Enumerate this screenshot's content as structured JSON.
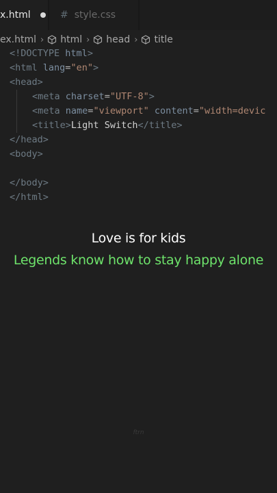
{
  "tabs": [
    {
      "label": "x.html",
      "active": true,
      "unsaved": true
    },
    {
      "label": "style.css",
      "active": false,
      "icon": "hash-icon"
    }
  ],
  "breadcrumb": [
    {
      "label": "ex.html"
    },
    {
      "label": "html",
      "icon": "cube-icon"
    },
    {
      "label": "head",
      "icon": "cube-icon"
    },
    {
      "label": "title",
      "icon": "cube-icon"
    }
  ],
  "code": {
    "l1": {
      "open": "<!",
      "kw": "DOCTYPE",
      "val": " html",
      "close": ">"
    },
    "l2": {
      "open": "<",
      "tag": "html",
      "attr": " lang",
      "eq": "=",
      "str": "\"en\"",
      "close": ">"
    },
    "l3": {
      "open": "<",
      "tag": "head",
      "close": ">"
    },
    "l4": {
      "open": "<",
      "tag": "meta",
      "attr": " charset",
      "eq": "=",
      "str": "\"UTF-8\"",
      "close": ">"
    },
    "l5": {
      "open": "<",
      "tag": "meta",
      "attr1": " name",
      "eq1": "=",
      "str1": "\"viewport\"",
      "attr2": " content",
      "eq2": "=",
      "str2": "\"width=devic"
    },
    "l6": {
      "open": "<",
      "tag": "title",
      "close": ">",
      "text": "Light Switch",
      "end_open": "</",
      "end_tag": "title",
      "end_close": ">"
    },
    "l7": {
      "open": "</",
      "tag": "head",
      "close": ">"
    },
    "l8": {
      "open": "<",
      "tag": "body",
      "close": ">"
    },
    "l10": {
      "open": "</",
      "tag": "body",
      "close": ">"
    },
    "l11": {
      "open": "</",
      "tag": "html",
      "close": ">"
    }
  },
  "captions": {
    "line1": "Love is for kids",
    "line2": "Legends know how to stay happy alone"
  },
  "watermark": "ftrn",
  "colors": {
    "background": "#1f1f1f",
    "caption_green": "#6ee36b",
    "caption_white": "#ffffff"
  }
}
